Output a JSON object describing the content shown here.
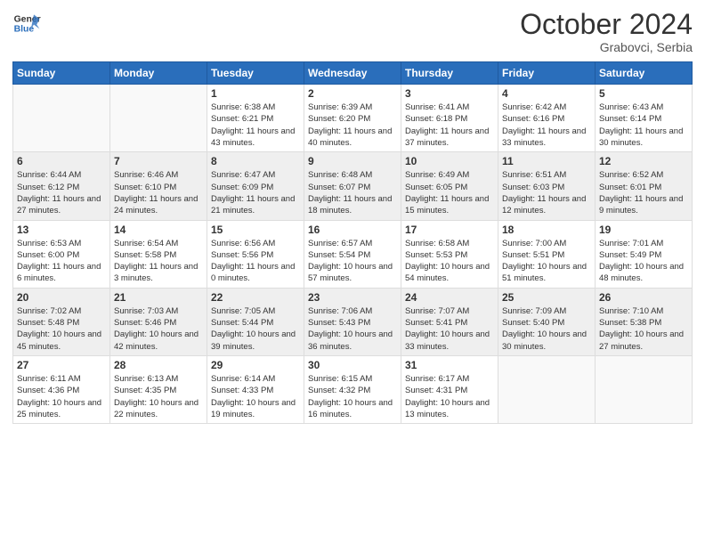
{
  "header": {
    "logo_line1": "General",
    "logo_line2": "Blue",
    "month": "October 2024",
    "location": "Grabovci, Serbia"
  },
  "weekdays": [
    "Sunday",
    "Monday",
    "Tuesday",
    "Wednesday",
    "Thursday",
    "Friday",
    "Saturday"
  ],
  "weeks": [
    [
      {
        "day": "",
        "info": ""
      },
      {
        "day": "",
        "info": ""
      },
      {
        "day": "1",
        "info": "Sunrise: 6:38 AM\nSunset: 6:21 PM\nDaylight: 11 hours and 43 minutes."
      },
      {
        "day": "2",
        "info": "Sunrise: 6:39 AM\nSunset: 6:20 PM\nDaylight: 11 hours and 40 minutes."
      },
      {
        "day": "3",
        "info": "Sunrise: 6:41 AM\nSunset: 6:18 PM\nDaylight: 11 hours and 37 minutes."
      },
      {
        "day": "4",
        "info": "Sunrise: 6:42 AM\nSunset: 6:16 PM\nDaylight: 11 hours and 33 minutes."
      },
      {
        "day": "5",
        "info": "Sunrise: 6:43 AM\nSunset: 6:14 PM\nDaylight: 11 hours and 30 minutes."
      }
    ],
    [
      {
        "day": "6",
        "info": "Sunrise: 6:44 AM\nSunset: 6:12 PM\nDaylight: 11 hours and 27 minutes."
      },
      {
        "day": "7",
        "info": "Sunrise: 6:46 AM\nSunset: 6:10 PM\nDaylight: 11 hours and 24 minutes."
      },
      {
        "day": "8",
        "info": "Sunrise: 6:47 AM\nSunset: 6:09 PM\nDaylight: 11 hours and 21 minutes."
      },
      {
        "day": "9",
        "info": "Sunrise: 6:48 AM\nSunset: 6:07 PM\nDaylight: 11 hours and 18 minutes."
      },
      {
        "day": "10",
        "info": "Sunrise: 6:49 AM\nSunset: 6:05 PM\nDaylight: 11 hours and 15 minutes."
      },
      {
        "day": "11",
        "info": "Sunrise: 6:51 AM\nSunset: 6:03 PM\nDaylight: 11 hours and 12 minutes."
      },
      {
        "day": "12",
        "info": "Sunrise: 6:52 AM\nSunset: 6:01 PM\nDaylight: 11 hours and 9 minutes."
      }
    ],
    [
      {
        "day": "13",
        "info": "Sunrise: 6:53 AM\nSunset: 6:00 PM\nDaylight: 11 hours and 6 minutes."
      },
      {
        "day": "14",
        "info": "Sunrise: 6:54 AM\nSunset: 5:58 PM\nDaylight: 11 hours and 3 minutes."
      },
      {
        "day": "15",
        "info": "Sunrise: 6:56 AM\nSunset: 5:56 PM\nDaylight: 11 hours and 0 minutes."
      },
      {
        "day": "16",
        "info": "Sunrise: 6:57 AM\nSunset: 5:54 PM\nDaylight: 10 hours and 57 minutes."
      },
      {
        "day": "17",
        "info": "Sunrise: 6:58 AM\nSunset: 5:53 PM\nDaylight: 10 hours and 54 minutes."
      },
      {
        "day": "18",
        "info": "Sunrise: 7:00 AM\nSunset: 5:51 PM\nDaylight: 10 hours and 51 minutes."
      },
      {
        "day": "19",
        "info": "Sunrise: 7:01 AM\nSunset: 5:49 PM\nDaylight: 10 hours and 48 minutes."
      }
    ],
    [
      {
        "day": "20",
        "info": "Sunrise: 7:02 AM\nSunset: 5:48 PM\nDaylight: 10 hours and 45 minutes."
      },
      {
        "day": "21",
        "info": "Sunrise: 7:03 AM\nSunset: 5:46 PM\nDaylight: 10 hours and 42 minutes."
      },
      {
        "day": "22",
        "info": "Sunrise: 7:05 AM\nSunset: 5:44 PM\nDaylight: 10 hours and 39 minutes."
      },
      {
        "day": "23",
        "info": "Sunrise: 7:06 AM\nSunset: 5:43 PM\nDaylight: 10 hours and 36 minutes."
      },
      {
        "day": "24",
        "info": "Sunrise: 7:07 AM\nSunset: 5:41 PM\nDaylight: 10 hours and 33 minutes."
      },
      {
        "day": "25",
        "info": "Sunrise: 7:09 AM\nSunset: 5:40 PM\nDaylight: 10 hours and 30 minutes."
      },
      {
        "day": "26",
        "info": "Sunrise: 7:10 AM\nSunset: 5:38 PM\nDaylight: 10 hours and 27 minutes."
      }
    ],
    [
      {
        "day": "27",
        "info": "Sunrise: 6:11 AM\nSunset: 4:36 PM\nDaylight: 10 hours and 25 minutes."
      },
      {
        "day": "28",
        "info": "Sunrise: 6:13 AM\nSunset: 4:35 PM\nDaylight: 10 hours and 22 minutes."
      },
      {
        "day": "29",
        "info": "Sunrise: 6:14 AM\nSunset: 4:33 PM\nDaylight: 10 hours and 19 minutes."
      },
      {
        "day": "30",
        "info": "Sunrise: 6:15 AM\nSunset: 4:32 PM\nDaylight: 10 hours and 16 minutes."
      },
      {
        "day": "31",
        "info": "Sunrise: 6:17 AM\nSunset: 4:31 PM\nDaylight: 10 hours and 13 minutes."
      },
      {
        "day": "",
        "info": ""
      },
      {
        "day": "",
        "info": ""
      }
    ]
  ]
}
